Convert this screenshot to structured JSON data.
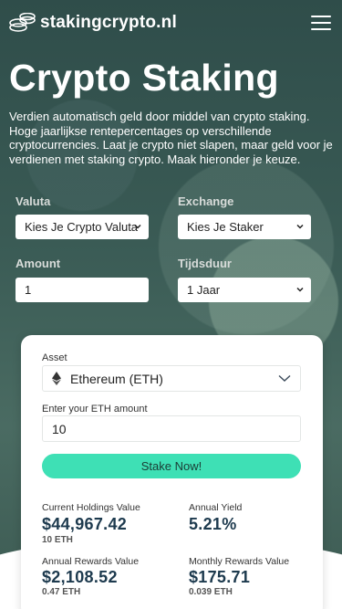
{
  "header": {
    "logo_text": "stakingcrypto.nl"
  },
  "hero": {
    "title": "Crypto Staking",
    "intro": "Verdien automatisch geld door middel van crypto staking. Hoge jaarlijkse rentepercentages op verschillende cryptocurrencies. Laat je crypto niet slapen, maar geld voor je verdienen met staking crypto. Maak hieronder je keuze."
  },
  "filters": {
    "valuta_label": "Valuta",
    "valuta_value": "Kies Je Crypto Valuta",
    "exchange_label": "Exchange",
    "exchange_value": "Kies Je Staker",
    "amount_label": "Amount",
    "amount_value": "1",
    "tijdsduur_label": "Tijdsduur",
    "tijdsduur_value": "1 Jaar"
  },
  "calculator": {
    "asset_label": "Asset",
    "asset_value": "Ethereum (ETH)",
    "amount_label": "Enter your ETH amount",
    "amount_value": "10",
    "stake_button": "Stake Now!",
    "stats": {
      "holdings_label": "Current Holdings Value",
      "holdings_value": "$44,967.42",
      "holdings_sub": "10 ETH",
      "yield_label": "Annual Yield",
      "yield_value": "5.21%",
      "annual_rewards_label": "Annual Rewards Value",
      "annual_rewards_value": "$2,108.52",
      "annual_rewards_sub": "0.47 ETH",
      "monthly_rewards_label": "Monthly Rewards Value",
      "monthly_rewards_value": "$175.71",
      "monthly_rewards_sub": "0.039 ETH"
    }
  },
  "icons": {
    "logo": "coin-stack-icon",
    "menu": "hamburger-menu-icon",
    "select_caret": "chevron-down-icon",
    "asset": "ethereum-icon"
  },
  "colors": {
    "accent": "#3ee0b5",
    "value_text": "#1d3a4e"
  }
}
